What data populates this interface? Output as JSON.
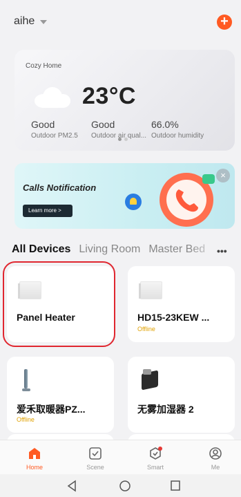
{
  "header": {
    "home_name": "aihe"
  },
  "weather": {
    "home_label": "Cozy Home",
    "temperature": "23°C",
    "metrics": [
      {
        "value": "Good",
        "label": "Outdoor PM2.5"
      },
      {
        "value": "Good",
        "label": "Outdoor air qual..."
      },
      {
        "value": "66.0%",
        "label": "Outdoor humidity"
      }
    ]
  },
  "banner": {
    "title": "Calls Notification",
    "button_label": "Learn more >",
    "close_symbol": "×"
  },
  "tabs": [
    {
      "label": "All Devices"
    },
    {
      "label": "Living Room"
    },
    {
      "label": "Master Bed"
    }
  ],
  "tabs_more": "•••",
  "devices": [
    {
      "name": "Panel Heater",
      "status": ""
    },
    {
      "name": "HD15-23KEW ...",
      "status": "Offline"
    },
    {
      "name": "爱禾取暖器PZ...",
      "status": "Offline"
    },
    {
      "name": "无雾加湿器 2",
      "status": ""
    }
  ],
  "nav": [
    {
      "label": "Home",
      "icon": "home-icon"
    },
    {
      "label": "Scene",
      "icon": "scene-icon"
    },
    {
      "label": "Smart",
      "icon": "smart-icon"
    },
    {
      "label": "Me",
      "icon": "me-icon"
    }
  ],
  "colors": {
    "accent": "#ff5a22",
    "offline": "#e0a100",
    "highlight": "#e0262f"
  }
}
